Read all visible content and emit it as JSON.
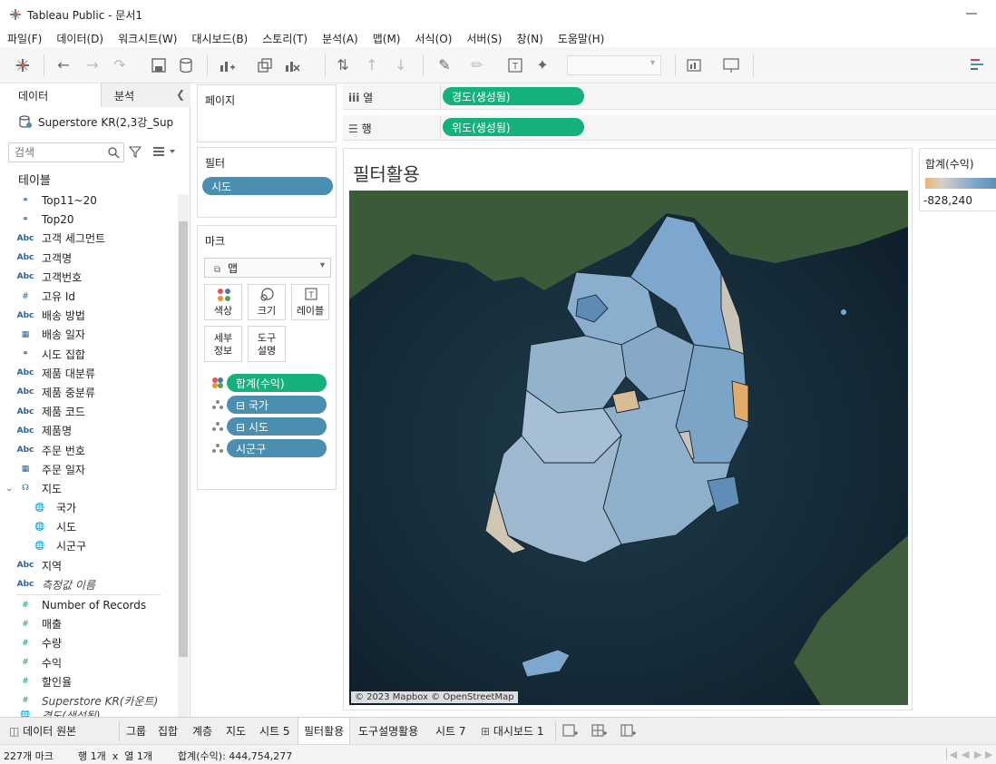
{
  "window": {
    "title": "Tableau Public - 문서1"
  },
  "menu": [
    "파일(F)",
    "데이터(D)",
    "워크시트(W)",
    "대시보드(B)",
    "스토리(T)",
    "분석(A)",
    "맵(M)",
    "서식(O)",
    "서버(S)",
    "창(N)",
    "도움말(H)"
  ],
  "toolbar": {
    "icons": [
      "tableau-logo-icon",
      "back-icon",
      "forward-icon",
      "redo-icon",
      "save-icon",
      "new-datasource-icon",
      "new-worksheet-icon",
      "duplicate-icon",
      "clear-icon",
      "swap-icon",
      "sort-asc-icon",
      "sort-desc-icon",
      "highlight-icon",
      "annotate-icon",
      "label-icon",
      "pin-icon",
      "show-me-icon",
      "presentation-icon"
    ],
    "fit_dropdown_value": ""
  },
  "left_panel": {
    "tab_data": "데이터",
    "tab_analysis": "분석",
    "datasource": "Superstore KR(2,3강_Sup...",
    "search_placeholder": "검색",
    "tables_header": "테이블",
    "fields": [
      {
        "label": "Top11~20",
        "type": "set"
      },
      {
        "label": "Top20",
        "type": "set"
      },
      {
        "label": "고객 세그먼트",
        "type": "abc"
      },
      {
        "label": "고객명",
        "type": "abc"
      },
      {
        "label": "고객번호",
        "type": "abc"
      },
      {
        "label": "고유 Id",
        "type": "num-dim"
      },
      {
        "label": "배송 방법",
        "type": "abc"
      },
      {
        "label": "배송 일자",
        "type": "date"
      },
      {
        "label": "시도 집합",
        "type": "set"
      },
      {
        "label": "제품 대분류",
        "type": "abc"
      },
      {
        "label": "제품 중분류",
        "type": "abc"
      },
      {
        "label": "제품 코드",
        "type": "abc"
      },
      {
        "label": "제품명",
        "type": "abc"
      },
      {
        "label": "주문 번호",
        "type": "abc"
      },
      {
        "label": "주문 일자",
        "type": "date"
      },
      {
        "label": "지도",
        "type": "hier"
      },
      {
        "label": "국가",
        "type": "geo"
      },
      {
        "label": "시도",
        "type": "geo"
      },
      {
        "label": "시군구",
        "type": "geo"
      },
      {
        "label": "지역",
        "type": "abc"
      },
      {
        "label": "측정값 이름",
        "type": "abc"
      },
      {
        "label": "Number of Records",
        "type": "measure"
      },
      {
        "label": "매출",
        "type": "measure"
      },
      {
        "label": "수량",
        "type": "measure"
      },
      {
        "label": "수익",
        "type": "measure"
      },
      {
        "label": "할인율",
        "type": "measure"
      },
      {
        "label": "Superstore KR(카운트)",
        "type": "measure"
      },
      {
        "label": "경도(생성됨)",
        "type": "geo-measure"
      }
    ]
  },
  "pages": {
    "title": "페이지"
  },
  "filters": {
    "title": "필터",
    "pills": [
      "시도"
    ]
  },
  "marks": {
    "title": "마크",
    "type": "맵",
    "buttons": {
      "color": "색상",
      "size": "크기",
      "label": "레이블",
      "detail": "세부\n정보",
      "tooltip": "도구\n설명"
    },
    "pills": [
      {
        "label": "합계(수익)",
        "kind": "color"
      },
      {
        "label": "⊟ 국가",
        "kind": "detail"
      },
      {
        "label": "⊟ 시도",
        "kind": "detail"
      },
      {
        "label": "시군구",
        "kind": "detail"
      }
    ]
  },
  "shelves": {
    "columns_label": "열",
    "columns_pill": "경도(생성됨)",
    "rows_label": "행",
    "rows_pill": "위도(생성됨)"
  },
  "view": {
    "title": "필터활용",
    "map_credit": "© 2023 Mapbox © OpenStreetMap"
  },
  "legend": {
    "title": "합계(수익)",
    "min_label": "-828,240",
    "colors": [
      "#e9b57a",
      "#d8d0c4",
      "#7da7cc",
      "#4e82ae"
    ]
  },
  "sheet_tabs": [
    "데이터 원본",
    "그룹",
    "집합",
    "계층",
    "지도",
    "시트 5",
    "필터활용",
    "도구설명활용",
    "시트 7",
    "대시보드 1"
  ],
  "status": {
    "marks": "227개 마크",
    "rows_cols": "행 1개  x  열 1개",
    "sum": "합계(수익): 444,754,277"
  }
}
